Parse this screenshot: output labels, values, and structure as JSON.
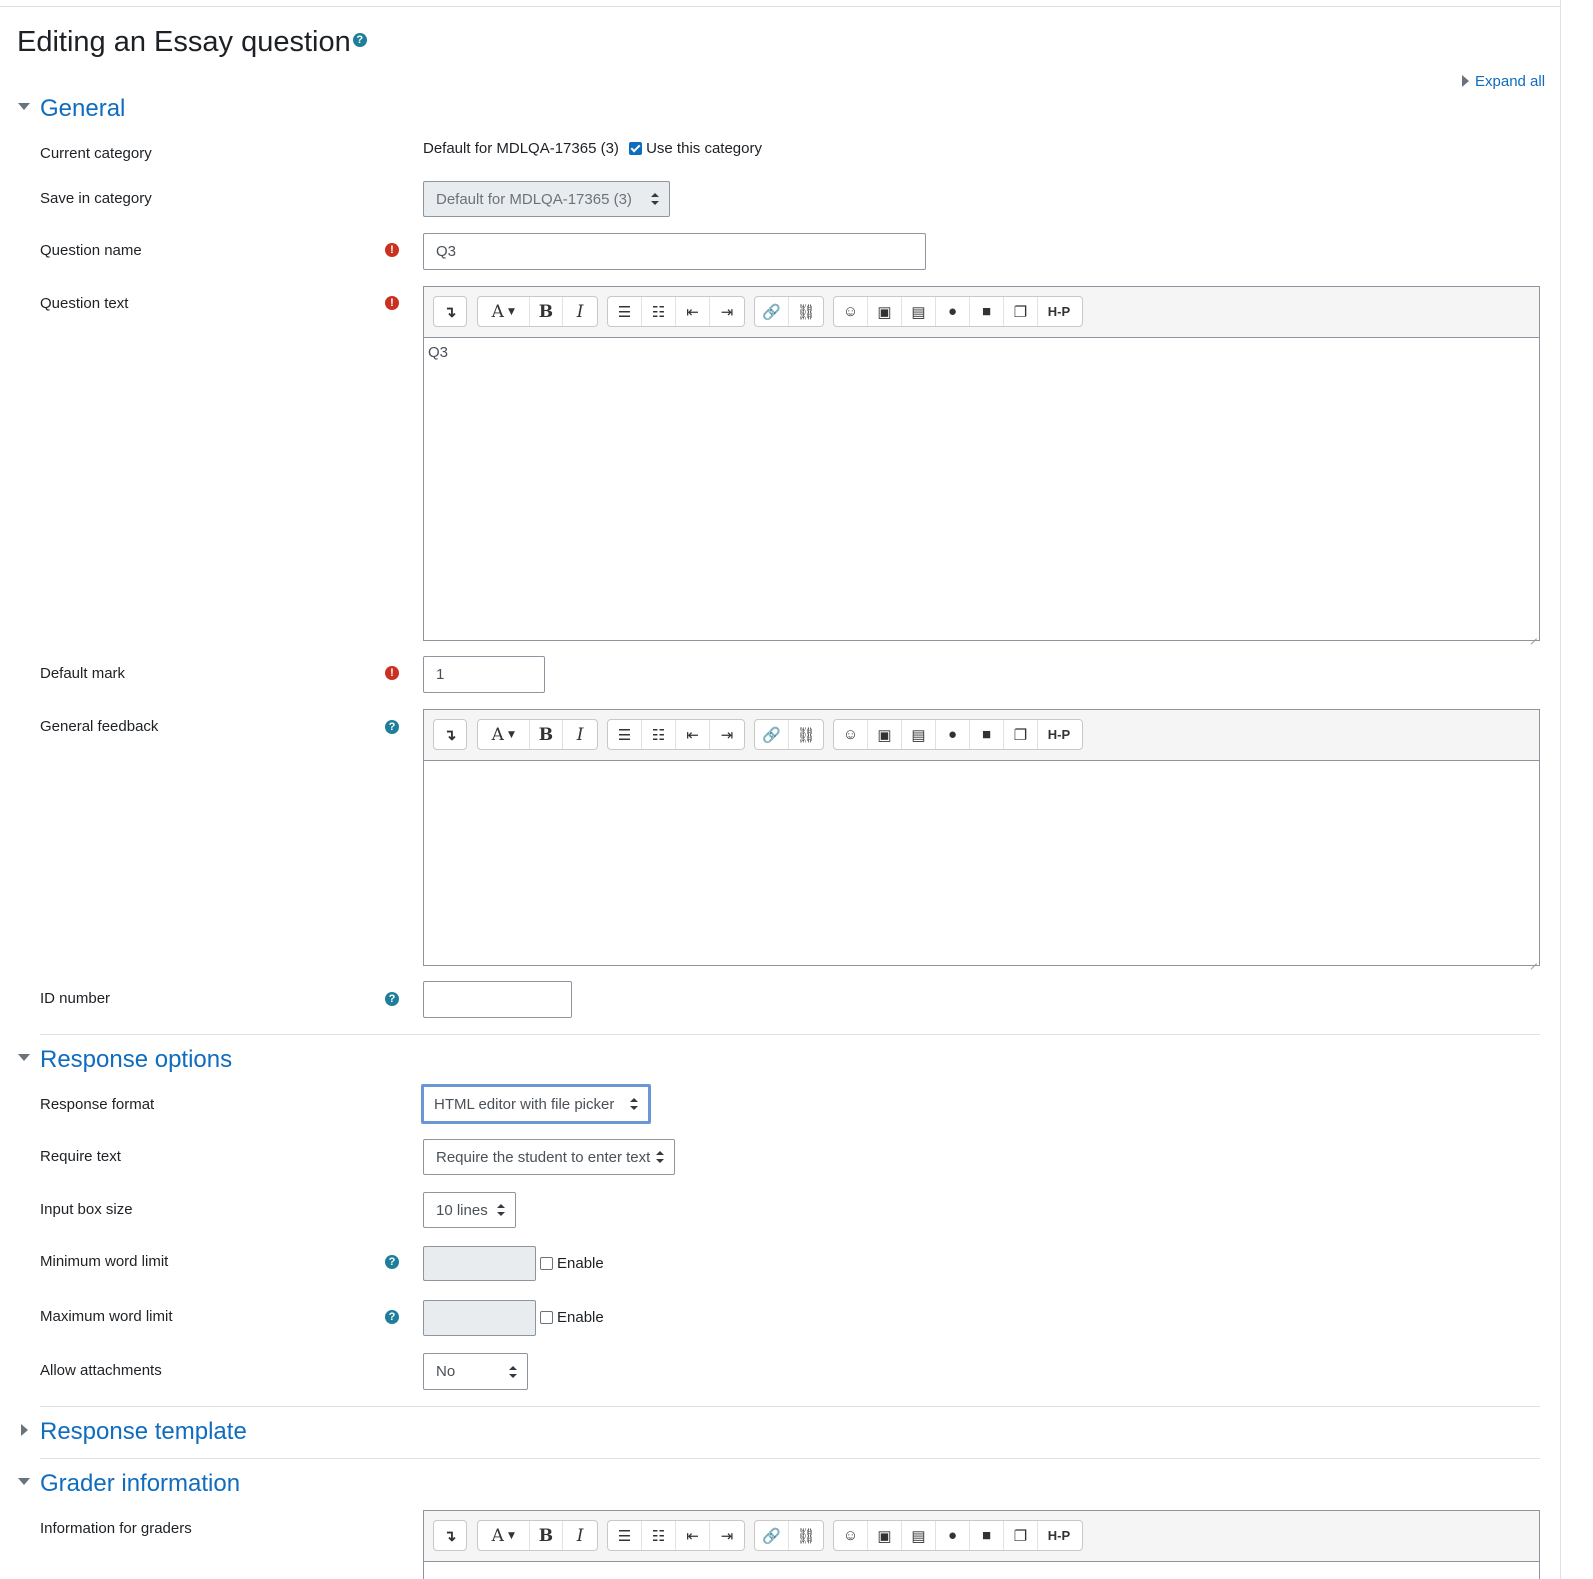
{
  "title": "Editing an Essay question",
  "title_help": "?",
  "expand_all": "Expand all",
  "sections": {
    "general": "General",
    "response_options": "Response options",
    "response_template": "Response template",
    "grader_information": "Grader information"
  },
  "general": {
    "current_category_label": "Current category",
    "current_category_value": "Default for MDLQA-17365 (3)",
    "use_this_category": "Use this category",
    "use_this_category_checked": true,
    "save_in_category_label": "Save in category",
    "save_in_category_value": "Default for MDLQA-17365 (3)",
    "question_name_label": "Question name",
    "question_name_value": "Q3",
    "question_text_label": "Question text",
    "question_text_value": "Q3",
    "default_mark_label": "Default mark",
    "default_mark_value": "1",
    "general_feedback_label": "General feedback",
    "general_feedback_value": "",
    "id_number_label": "ID number",
    "id_number_value": ""
  },
  "response_options": {
    "response_format_label": "Response format",
    "response_format_value": "HTML editor with file picker",
    "require_text_label": "Require text",
    "require_text_value": "Require the student to enter text",
    "input_box_size_label": "Input box size",
    "input_box_size_value": "10 lines",
    "min_word_limit_label": "Minimum word limit",
    "max_word_limit_label": "Maximum word limit",
    "enable_label": "Enable",
    "allow_attachments_label": "Allow attachments",
    "allow_attachments_value": "No"
  },
  "grader_information": {
    "information_for_graders_label": "Information for graders"
  },
  "icons": {
    "required": "!",
    "help": "?"
  },
  "toolbar": {
    "collapse": "↴",
    "font": "A",
    "bold": "B",
    "italic": "I",
    "h5p": "H-P"
  },
  "colors": {
    "link": "#0f6cbf",
    "required": "#ca3120",
    "help": "#1f7e9a",
    "focus": "#6b96d6"
  }
}
